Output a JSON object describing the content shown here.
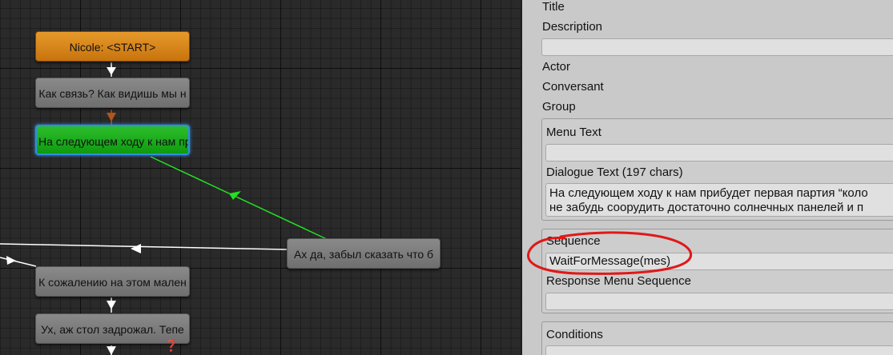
{
  "graph": {
    "nodes": {
      "start": "Nicole: <START>",
      "n1": "Как связь? Как видишь мы н",
      "n2": "На следующем ходу к нам пр",
      "n3": "Ах да, забыл сказать что б",
      "n4": "К сожалению на этом мален",
      "n5": "Ух, аж стол задрожал. Тепе"
    },
    "colors": {
      "start": "#d9861b",
      "selected": "#1fae1f",
      "normal": "#7d7d7d",
      "selected_link": "#22e022"
    }
  },
  "inspector": {
    "title_label": "Title",
    "description_label": "Description",
    "description_value": "",
    "actor_label": "Actor",
    "conversant_label": "Conversant",
    "group_label": "Group",
    "menu_text_label": "Menu Text",
    "menu_text_value": "",
    "dialogue_text_label": "Dialogue Text (197 chars)",
    "dialogue_text_line1": "На следующем ходу к нам прибудет первая партия “коло",
    "dialogue_text_line2": "не забудь соорудить достаточно солнечных панелей и п",
    "sequence_label": "Sequence",
    "sequence_value": "WaitForMessage(mes)",
    "response_menu_sequence_label": "Response Menu Sequence",
    "response_menu_sequence_value": "",
    "conditions_label": "Conditions",
    "conditions_value": ""
  },
  "annotation": {
    "color": "#e01818"
  }
}
